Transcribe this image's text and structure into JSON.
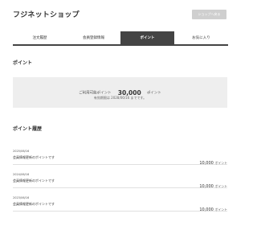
{
  "header": {
    "shop_title": "フジネットショップ",
    "shop_button_label": "ショップへ戻る"
  },
  "tabs": [
    {
      "label": "注文履歴",
      "active": false
    },
    {
      "label": "会員登録情報",
      "active": false
    },
    {
      "label": "ポイント",
      "active": true
    },
    {
      "label": "お気に入り",
      "active": false
    }
  ],
  "points_section": {
    "title": "ポイント",
    "available_label": "ご利用可能ポイント",
    "available_value": "30,000",
    "unit": "ポイント",
    "expiry_text": "有効期限は 2028/06/16 までです。"
  },
  "history_section": {
    "title": "ポイント履歴",
    "rows": [
      {
        "date": "2025/06/16",
        "description": "会員情報更新のポイントです",
        "amount": "10,000",
        "unit": "ポイント"
      },
      {
        "date": "2024/06/16",
        "description": "会員情報更新のポイントです",
        "amount": "10,000",
        "unit": "ポイント"
      },
      {
        "date": "2023/06/16",
        "description": "会員情報更新のポイントです",
        "amount": "10,000",
        "unit": "ポイント"
      }
    ]
  },
  "colors": {
    "accent": "#444444",
    "panel": "#eeeeee",
    "button": "#cfcfcf"
  }
}
